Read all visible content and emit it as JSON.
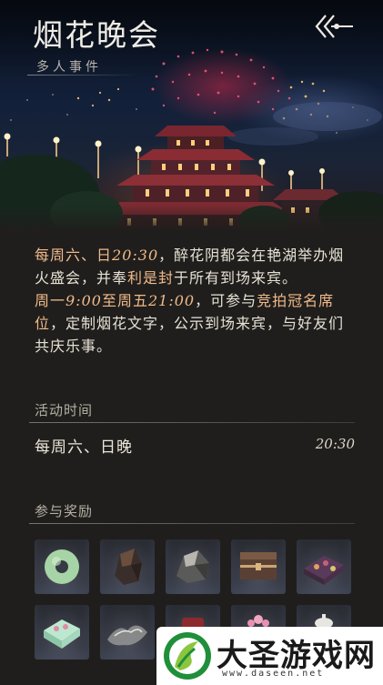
{
  "header": {
    "title": "烟花晚会",
    "subtitle": "多人事件"
  },
  "description": {
    "line1_prefix": "每周六、日",
    "line1_time": "20:30",
    "line1_mid": "，醉花阴都会在艳湖举办烟火盛会，并奉",
    "line1_reward": "利是封",
    "line1_suffix": "于所有到场来宾。",
    "line2_prefix": "周一",
    "line2_start": "9:00",
    "line2_mid": "至周五",
    "line2_end": "21:00",
    "line2_text": "，可参与",
    "line2_bid": "竞拍冠名席位",
    "line2_suffix": "，定制烟花文字，公示到场来宾，与好友们共庆乐事。"
  },
  "schedule": {
    "section_title": "活动时间",
    "days": "每周六、日晚",
    "time": "20:30"
  },
  "rewards": {
    "section_title": "参与奖励",
    "items": [
      {
        "icon": "jade-ring-icon"
      },
      {
        "icon": "dark-ore-icon"
      },
      {
        "icon": "silver-ore-icon"
      },
      {
        "icon": "treasure-chest-icon"
      },
      {
        "icon": "jewel-box-icon"
      },
      {
        "icon": "jade-box-icon"
      },
      {
        "icon": "silver-ingot-icon"
      },
      {
        "icon": "red-item-icon"
      },
      {
        "icon": "flower-item-icon"
      },
      {
        "icon": "teapot-icon"
      }
    ]
  },
  "watermark": {
    "name": "大圣游戏网",
    "url": "www.daseen.net"
  },
  "colors": {
    "background": "#1f1e1c",
    "highlight": "#f0b98a",
    "text": "#e8e2d6"
  }
}
